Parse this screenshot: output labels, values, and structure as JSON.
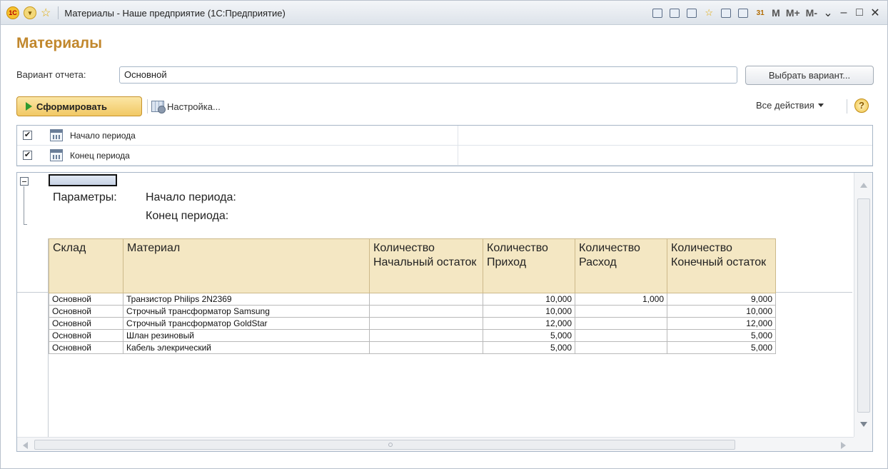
{
  "window": {
    "title": "Материалы - Наше предприятие  (1С:Предприятие)",
    "logo": "1С",
    "memory_buttons": [
      "M",
      "M+",
      "M-"
    ],
    "controls": {
      "minimize": "–",
      "restore": "□",
      "close": "✕"
    }
  },
  "form": {
    "title": "Материалы",
    "variant_label": "Вариант отчета:",
    "variant_value": "Основной",
    "choose_variant": "Выбрать вариант...",
    "generate": "Сформировать",
    "settings": "Настройка...",
    "all_actions": "Все действия",
    "help": "?"
  },
  "params": [
    {
      "checked": true,
      "label": "Начало периода"
    },
    {
      "checked": true,
      "label": "Конец периода"
    }
  ],
  "report": {
    "params_title": "Параметры:",
    "param_1": "Начало периода:",
    "param_2": "Конец периода:",
    "headers": [
      "Склад",
      "Материал",
      "Количество Начальный остаток",
      "Количество Приход",
      "Количество Расход",
      "Количество Конечный остаток"
    ],
    "rows": [
      [
        "Основной",
        "Транзистор Philips 2N2369",
        "",
        "10,000",
        "1,000",
        "9,000"
      ],
      [
        "Основной",
        "Строчный трансформатор Samsung",
        "",
        "10,000",
        "",
        "10,000"
      ],
      [
        "Основной",
        "Строчный трансформатор GoldStar",
        "",
        "12,000",
        "",
        "12,000"
      ],
      [
        "Основной",
        "Шлан резиновый",
        "",
        "5,000",
        "",
        "5,000"
      ],
      [
        "Основной",
        "Кабель элекрический",
        "",
        "5,000",
        "",
        "5,000"
      ]
    ]
  }
}
